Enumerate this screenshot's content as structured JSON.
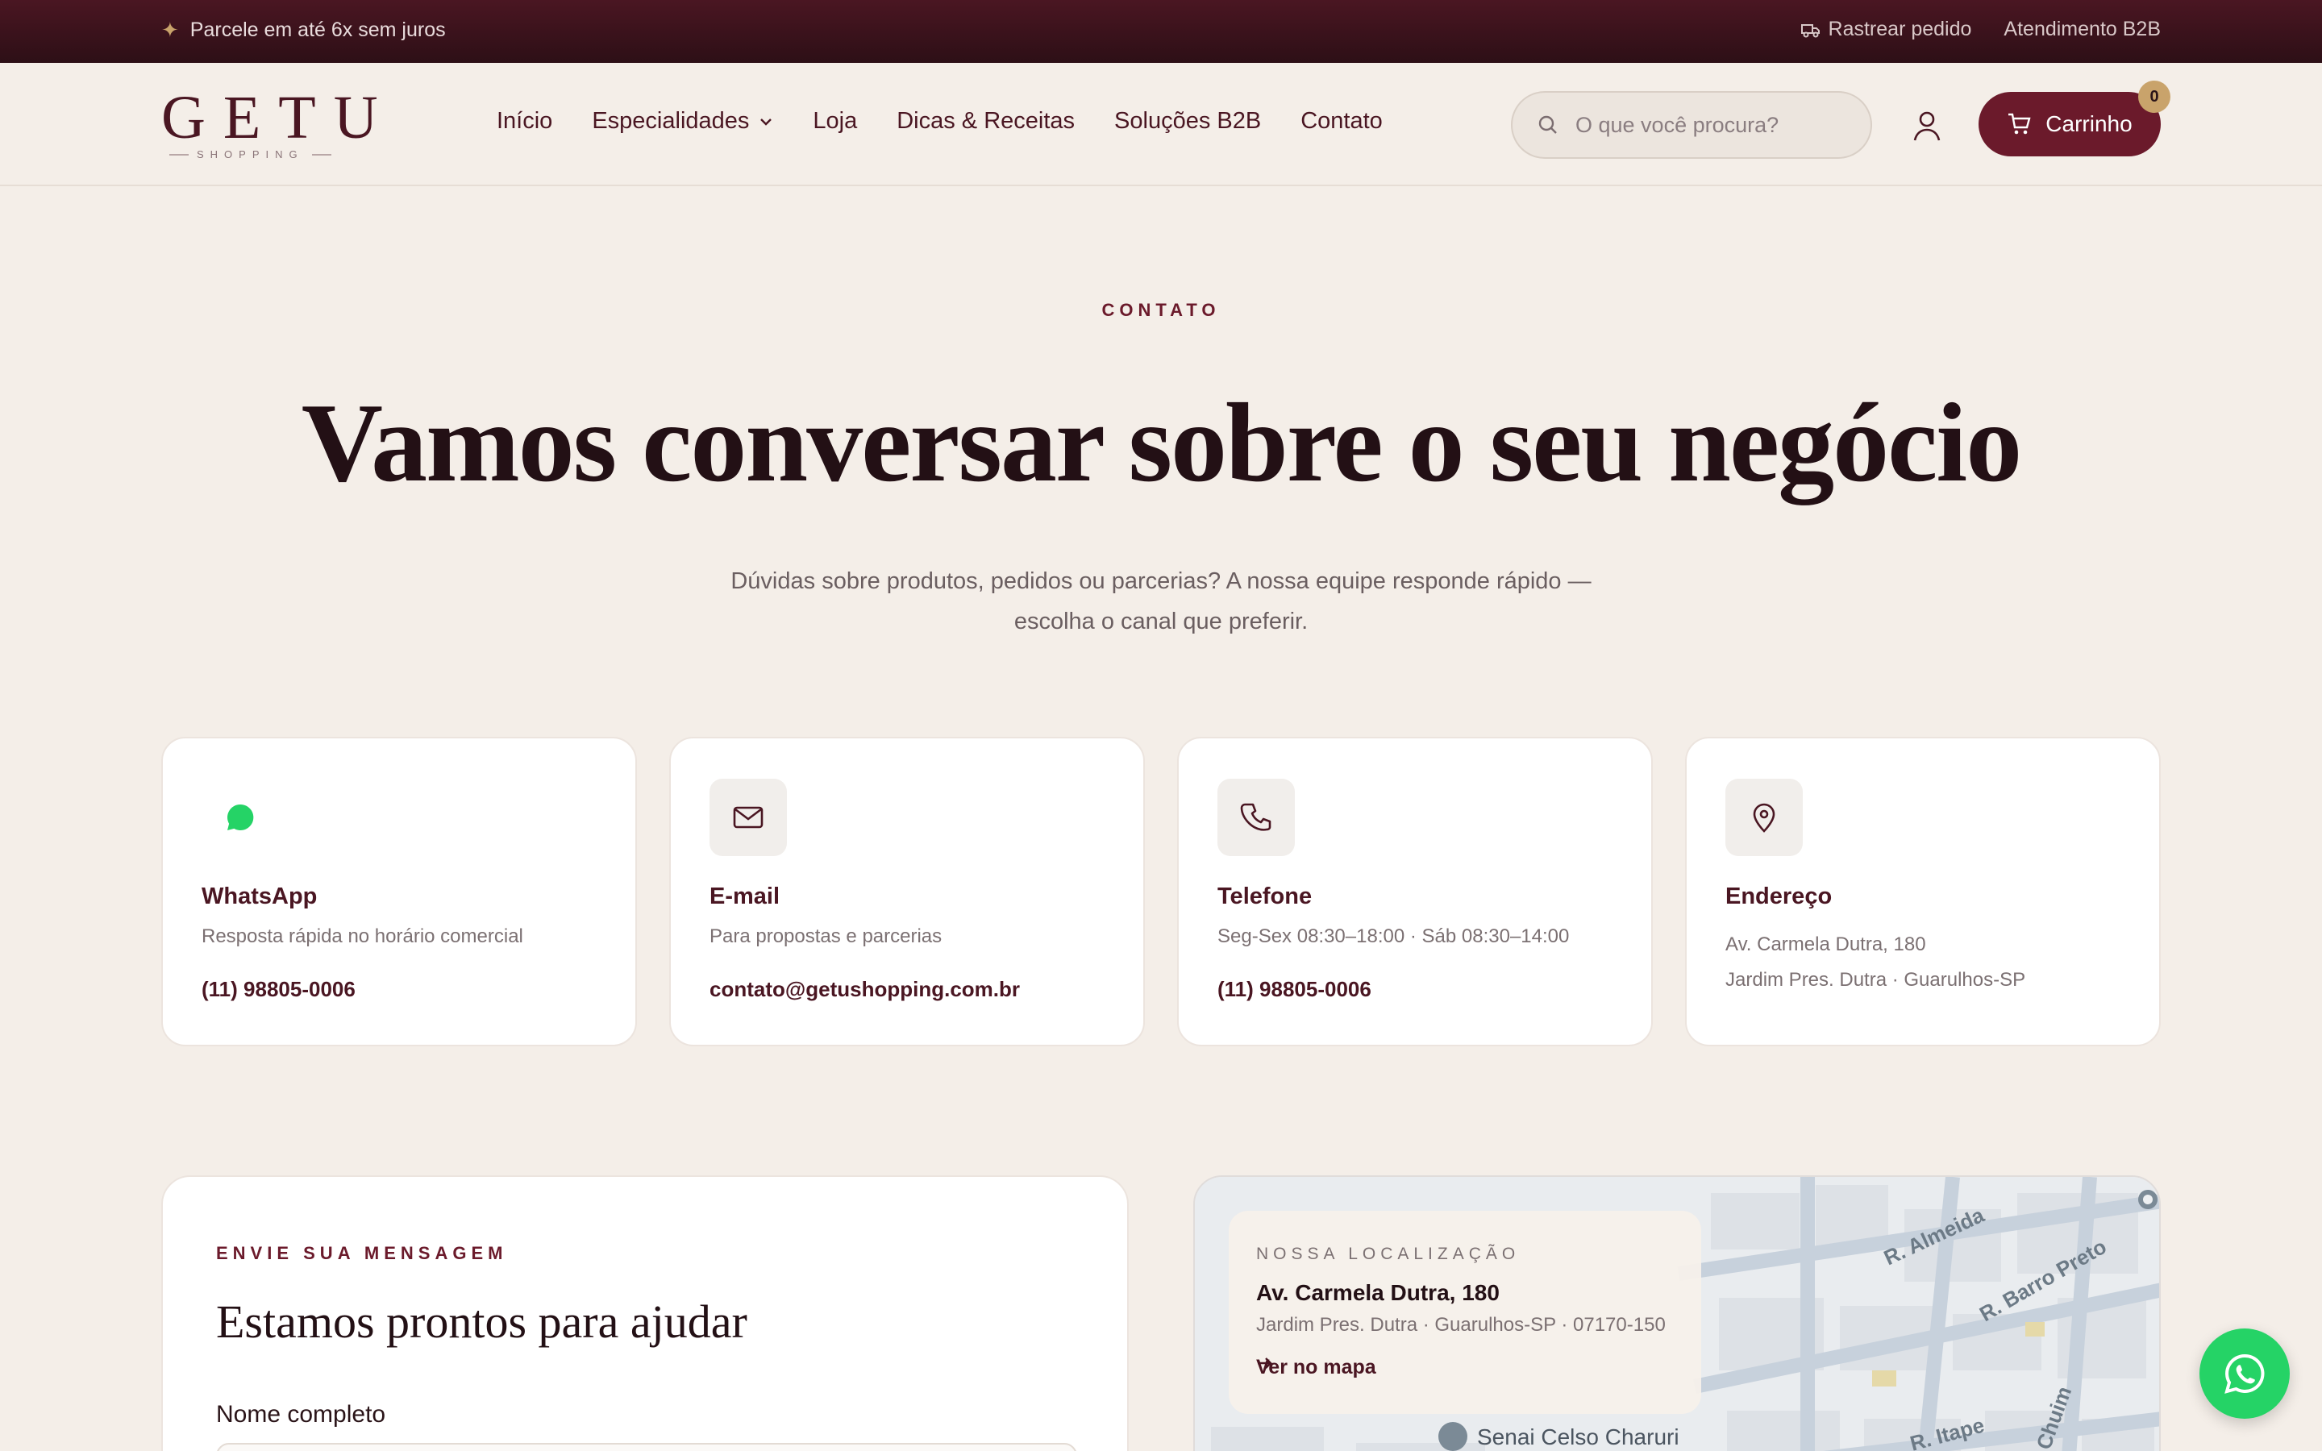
{
  "topbar": {
    "promo": "Parcele em até 6x sem juros",
    "track_order": "Rastrear pedido",
    "b2b_service": "Atendimento B2B"
  },
  "brand": {
    "logo_word": "GETU",
    "logo_sub": "SHOPPING"
  },
  "nav": {
    "items": [
      "Início",
      "Especialidades",
      "Loja",
      "Dicas & Receitas",
      "Soluções B2B",
      "Contato"
    ]
  },
  "search": {
    "placeholder": "O que você procura?"
  },
  "cart": {
    "label": "Carrinho",
    "count": "0"
  },
  "hero": {
    "eyebrow": "CONTATO",
    "title": "Vamos conversar sobre o seu negócio",
    "subtitle_line1": "Dúvidas sobre produtos, pedidos ou parcerias? A nossa equipe responde rápido —",
    "subtitle_line2": "escolha o canal que preferir."
  },
  "contact_cards": [
    {
      "icon": "whatsapp-icon",
      "title": "WhatsApp",
      "description": "Resposta rápida no horário comercial",
      "value": "(11) 98805-0006"
    },
    {
      "icon": "mail-icon",
      "title": "E-mail",
      "description": "Para propostas e parcerias",
      "value": "contato@getushopping.com.br"
    },
    {
      "icon": "phone-icon",
      "title": "Telefone",
      "description": "Seg-Sex 08:30–18:00 · Sáb 08:30–14:00",
      "value": "(11) 98805-0006"
    },
    {
      "icon": "map-pin-icon",
      "title": "Endereço",
      "line1": "Av. Carmela Dutra, 180",
      "line2": "Jardim Pres. Dutra · Guarulhos-SP"
    }
  ],
  "form": {
    "eyebrow": "ENVIE SUA MENSAGEM",
    "title": "Estamos prontos para ajudar",
    "name_label": "Nome completo"
  },
  "map": {
    "eyebrow": "NOSSA LOCALIZAÇÃO",
    "street": "Av. Carmela Dutra, 180",
    "city": "Jardim Pres. Dutra · Guarulhos-SP · 07170-150",
    "link": "Ver no mapa",
    "street_labels": [
      "R. Almeida",
      "R. Barro Preto",
      "R. Itape",
      "Chuim",
      "Senai Celso Charuri"
    ]
  },
  "colors": {
    "brand": "#6b1a2b",
    "accent_gold": "#c9a36b",
    "background": "#f4eee8",
    "whatsapp": "#25d366"
  }
}
